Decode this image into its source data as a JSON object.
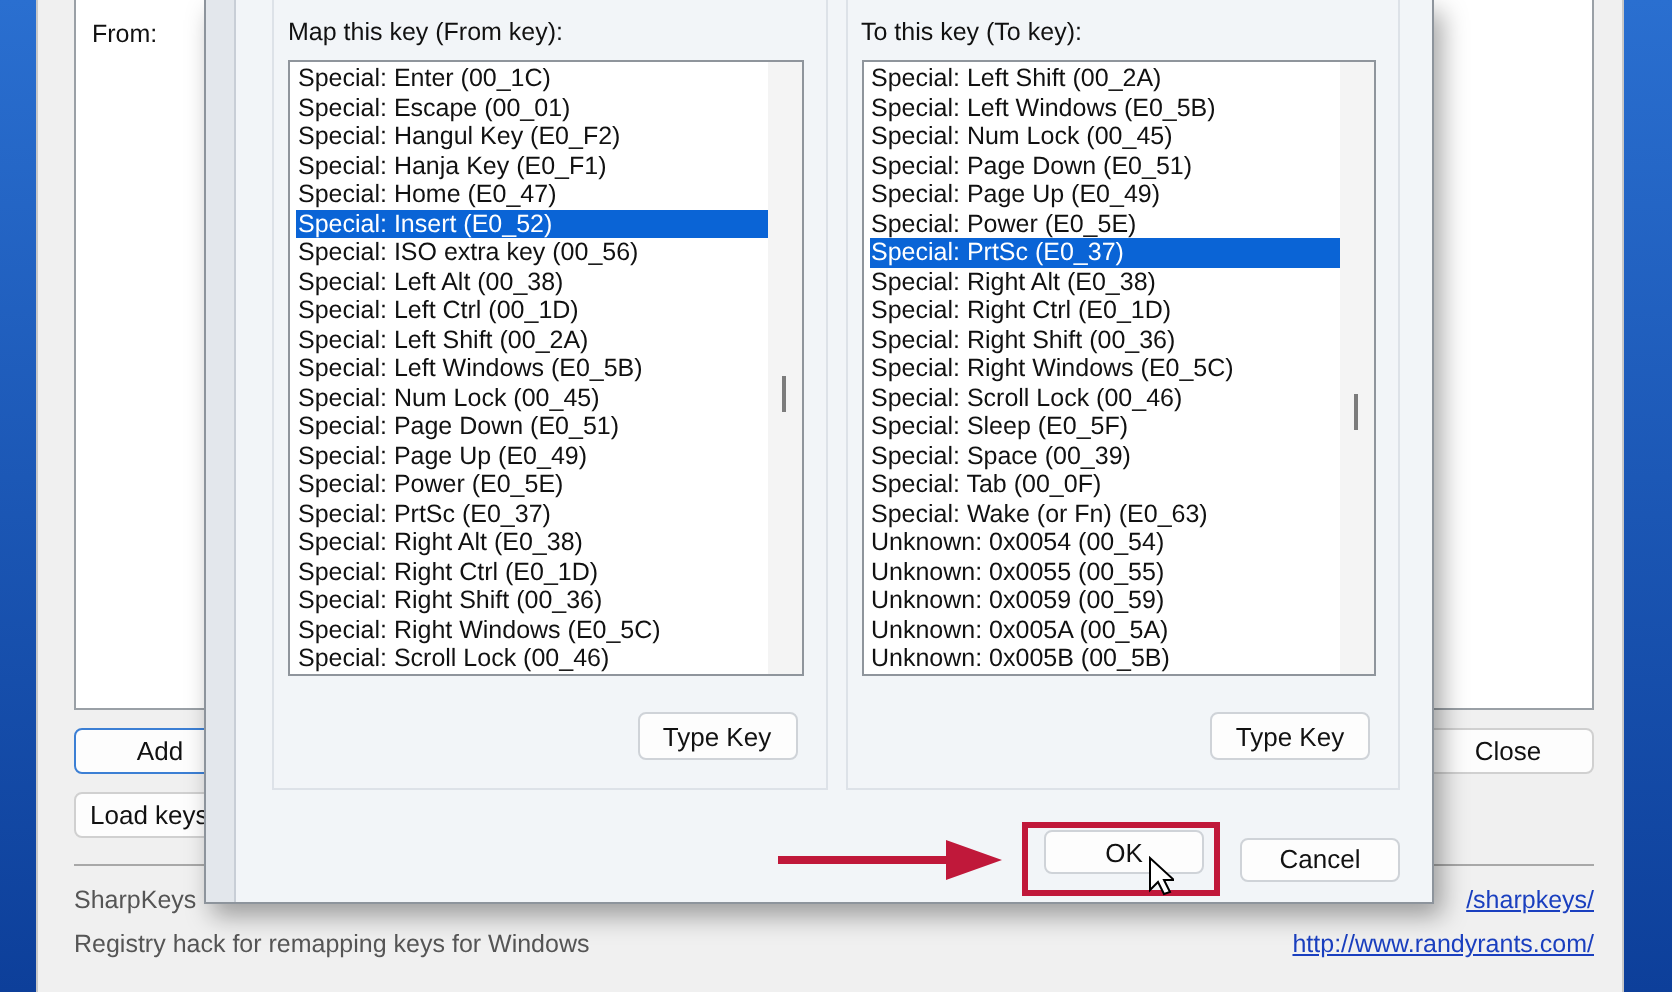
{
  "main_window": {
    "list_header": "From:",
    "buttons": [
      {
        "label": "Add",
        "default": true,
        "kind": "left"
      },
      {
        "label": "Load keys",
        "default": false,
        "kind": "left"
      },
      {
        "label": "Close",
        "default": false,
        "kind": "right"
      }
    ],
    "footer": {
      "app_name": "SharpKeys",
      "description": "Registry hack for remapping keys for Windows",
      "links": [
        "/sharpkeys/",
        "http://www.randyrants.com/"
      ]
    }
  },
  "dialog": {
    "panels": [
      {
        "label": "Map this key (From key):",
        "button": "Type Key",
        "items": [
          {
            "text": "Special: Enter (00_1C)",
            "selected": false
          },
          {
            "text": "Special: Escape (00_01)",
            "selected": false
          },
          {
            "text": "Special: Hangul Key (E0_F2)",
            "selected": false
          },
          {
            "text": "Special: Hanja Key (E0_F1)",
            "selected": false
          },
          {
            "text": "Special: Home (E0_47)",
            "selected": false
          },
          {
            "text": "Special: Insert (E0_52)",
            "selected": true
          },
          {
            "text": "Special: ISO extra key (00_56)",
            "selected": false
          },
          {
            "text": "Special: Left Alt (00_38)",
            "selected": false
          },
          {
            "text": "Special: Left Ctrl (00_1D)",
            "selected": false
          },
          {
            "text": "Special: Left Shift (00_2A)",
            "selected": false
          },
          {
            "text": "Special: Left Windows (E0_5B)",
            "selected": false
          },
          {
            "text": "Special: Num Lock (00_45)",
            "selected": false
          },
          {
            "text": "Special: Page Down (E0_51)",
            "selected": false
          },
          {
            "text": "Special: Page Up (E0_49)",
            "selected": false
          },
          {
            "text": "Special: Power (E0_5E)",
            "selected": false
          },
          {
            "text": "Special: PrtSc (E0_37)",
            "selected": false
          },
          {
            "text": "Special: Right Alt (E0_38)",
            "selected": false
          },
          {
            "text": "Special: Right Ctrl (E0_1D)",
            "selected": false
          },
          {
            "text": "Special: Right Shift (00_36)",
            "selected": false
          },
          {
            "text": "Special: Right Windows (E0_5C)",
            "selected": false
          },
          {
            "text": "Special: Scroll Lock (00_46)",
            "selected": false
          }
        ]
      },
      {
        "label": "To this key (To key):",
        "button": "Type Key",
        "items": [
          {
            "text": "Special: Left Shift (00_2A)",
            "selected": false
          },
          {
            "text": "Special: Left Windows (E0_5B)",
            "selected": false
          },
          {
            "text": "Special: Num Lock (00_45)",
            "selected": false
          },
          {
            "text": "Special: Page Down (E0_51)",
            "selected": false
          },
          {
            "text": "Special: Page Up (E0_49)",
            "selected": false
          },
          {
            "text": "Special: Power (E0_5E)",
            "selected": false
          },
          {
            "text": "Special: PrtSc (E0_37)",
            "selected": true
          },
          {
            "text": "Special: Right Alt (E0_38)",
            "selected": false
          },
          {
            "text": "Special: Right Ctrl (E0_1D)",
            "selected": false
          },
          {
            "text": "Special: Right Shift (00_36)",
            "selected": false
          },
          {
            "text": "Special: Right Windows (E0_5C)",
            "selected": false
          },
          {
            "text": "Special: Scroll Lock (00_46)",
            "selected": false
          },
          {
            "text": "Special: Sleep (E0_5F)",
            "selected": false
          },
          {
            "text": "Special: Space (00_39)",
            "selected": false
          },
          {
            "text": "Special: Tab (00_0F)",
            "selected": false
          },
          {
            "text": "Special: Wake (or Fn) (E0_63)",
            "selected": false
          },
          {
            "text": "Unknown: 0x0054 (00_54)",
            "selected": false
          },
          {
            "text": "Unknown: 0x0055 (00_55)",
            "selected": false
          },
          {
            "text": "Unknown: 0x0059 (00_59)",
            "selected": false
          },
          {
            "text": "Unknown: 0x005A (00_5A)",
            "selected": false
          },
          {
            "text": "Unknown: 0x005B (00_5B)",
            "selected": false
          }
        ]
      }
    ],
    "buttons": [
      {
        "label": "OK",
        "highlighted": true
      },
      {
        "label": "Cancel",
        "highlighted": false
      }
    ]
  }
}
